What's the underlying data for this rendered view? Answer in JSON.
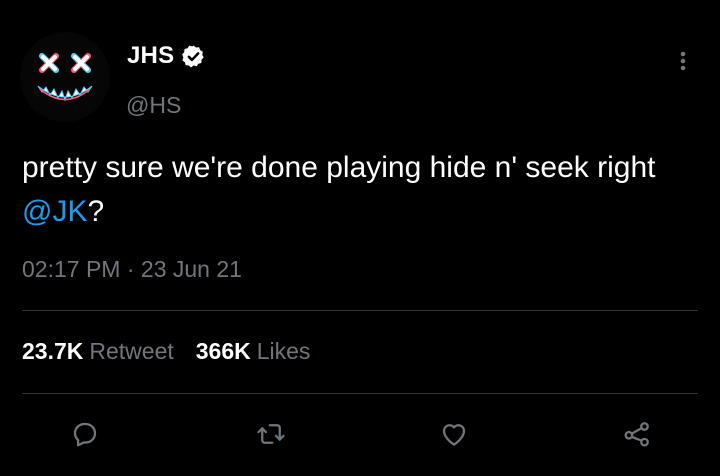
{
  "author": {
    "display_name": "JHS",
    "handle": "@HS",
    "avatar_icon": "x-eyes-smiley-avatar",
    "verified_icon": "verified-badge-icon"
  },
  "tweet": {
    "text_before": "pretty sure we're done playing hide n' seek right ",
    "mention": "@JK",
    "text_after": "?",
    "time": "02:17 PM",
    "separator": " · ",
    "date": "23 Jun 21"
  },
  "stats": {
    "retweets_count": "23.7K",
    "retweets_label": "Retweet",
    "likes_count": "366K",
    "likes_label": "Likes"
  },
  "actions": [
    "reply-icon",
    "retweet-icon",
    "like-icon",
    "share-icon"
  ],
  "colors": {
    "accent": "#1d9bf0",
    "muted": "#71767b",
    "divider": "#2f3336",
    "background": "#000000"
  }
}
